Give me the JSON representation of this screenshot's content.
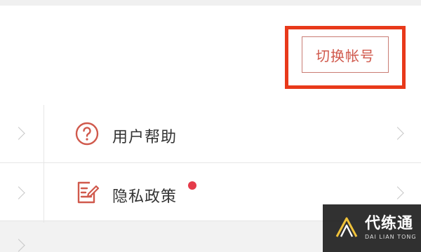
{
  "account": {
    "switch_label": "切换帐号"
  },
  "menu": {
    "items": [
      {
        "label": "用户帮助",
        "icon": "help-circle-icon",
        "badge": false
      },
      {
        "label": "隐私政策",
        "icon": "policy-edit-icon",
        "badge": true
      }
    ]
  },
  "watermark": {
    "title": "代练通",
    "subtitle": "DAI LIAN TONG"
  },
  "colors": {
    "accent_red": "#d0594c",
    "highlight": "#e8391a",
    "badge": "#e53b4a"
  }
}
